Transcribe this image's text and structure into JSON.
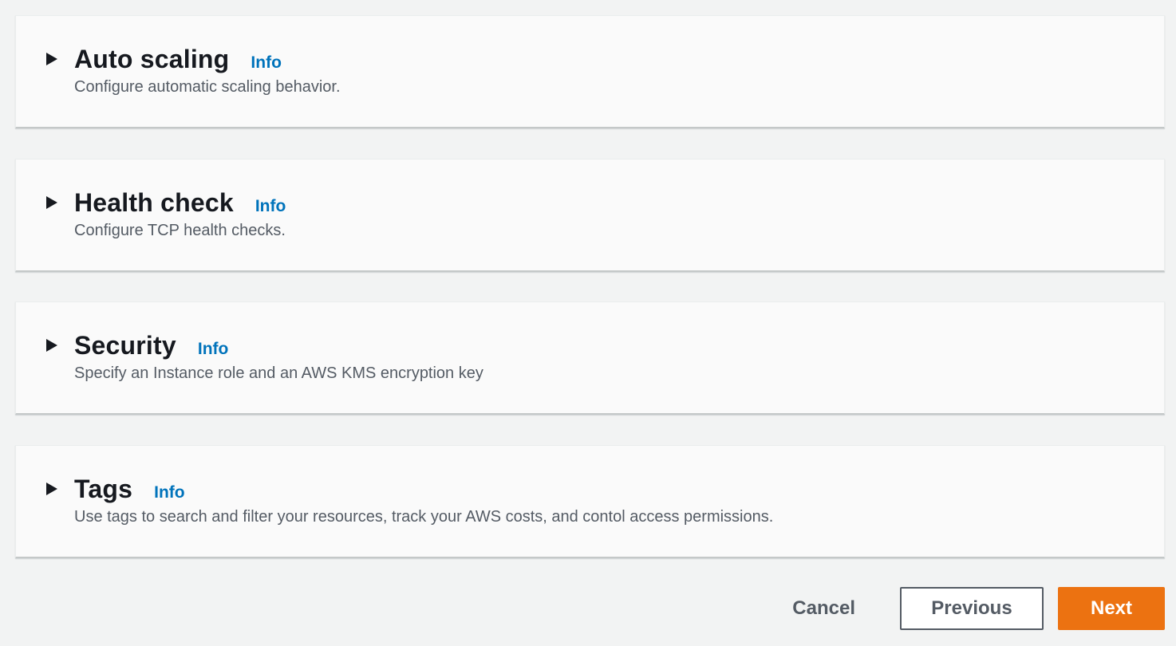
{
  "sections": [
    {
      "title": "Auto scaling",
      "info": "Info",
      "description": "Configure automatic scaling behavior.",
      "expanded": false,
      "icon": "caret-right-icon"
    },
    {
      "title": "Health check",
      "info": "Info",
      "description": "Configure TCP health checks.",
      "expanded": false,
      "icon": "caret-right-icon"
    },
    {
      "title": "Security",
      "info": "Info",
      "description": "Specify an Instance role and an AWS KMS encryption key",
      "expanded": false,
      "icon": "caret-right-icon"
    },
    {
      "title": "Tags",
      "info": "Info",
      "description": "Use tags to search and filter your resources, track your AWS costs, and contol access permissions.",
      "expanded": false,
      "icon": "caret-right-icon"
    }
  ],
  "actions": {
    "cancel_label": "Cancel",
    "previous_label": "Previous",
    "next_label": "Next"
  },
  "colors": {
    "link": "#0073bb",
    "primary_button": "#ec7211",
    "background": "#f2f3f3",
    "panel": "#fafafa"
  }
}
